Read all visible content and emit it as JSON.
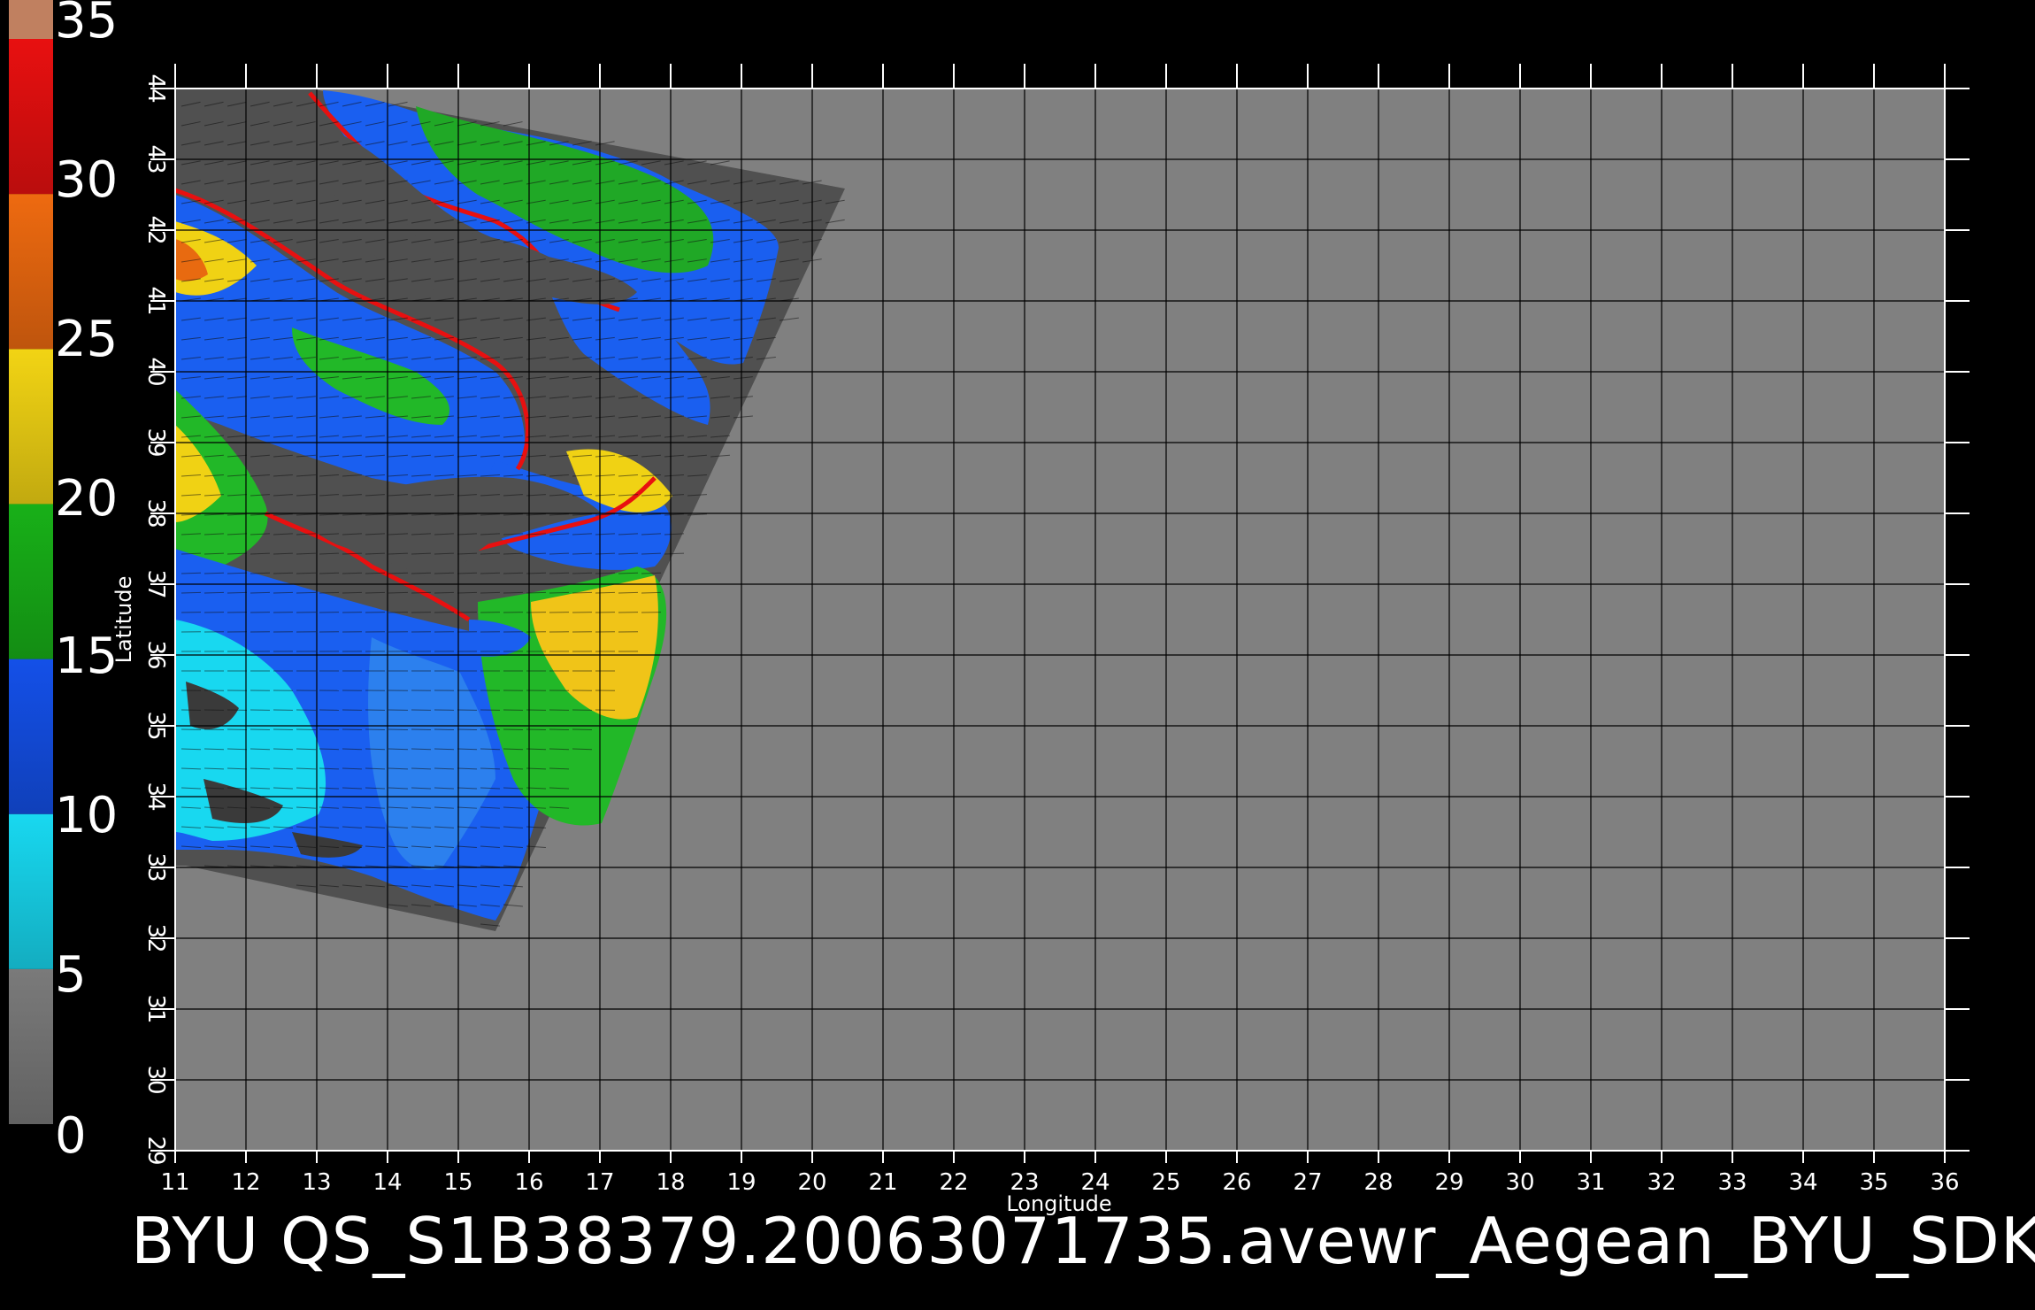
{
  "colorbar": {
    "ticks": [
      "0",
      "5",
      "10",
      "15",
      "20",
      "25",
      "30",
      "35"
    ],
    "min": 0,
    "max": 35,
    "bands": [
      {
        "from": 0,
        "to": 5,
        "color": "#7a7a7a"
      },
      {
        "from": 5,
        "to": 10,
        "color": "#18d8f0"
      },
      {
        "from": 10,
        "to": 15,
        "color": "#1450e8"
      },
      {
        "from": 15,
        "to": 20,
        "color": "#18b018"
      },
      {
        "from": 20,
        "to": 25,
        "color": "#f2d414"
      },
      {
        "from": 25,
        "to": 30,
        "color": "#ee6a10"
      },
      {
        "from": 30,
        "to": 35,
        "color": "#e81010"
      }
    ],
    "top_cap_color": "#c08060"
  },
  "map": {
    "xlabel": "Longitude",
    "ylabel": "Latitude",
    "lon_ticks": [
      "11",
      "12",
      "13",
      "14",
      "15",
      "16",
      "17",
      "18",
      "19",
      "20",
      "21",
      "22",
      "23",
      "24",
      "25",
      "26",
      "27",
      "28",
      "29",
      "30",
      "31",
      "32",
      "33",
      "34",
      "35",
      "36"
    ],
    "lat_ticks": [
      "29",
      "30",
      "31",
      "32",
      "33",
      "34",
      "35",
      "36",
      "37",
      "38",
      "39",
      "40",
      "41",
      "42",
      "43",
      "44"
    ],
    "lon_range": [
      11,
      36
    ],
    "lat_range": [
      29,
      44
    ],
    "background_color": "#808080",
    "swath_color": "#505050",
    "grid_color": "#000000"
  },
  "caption": "BYU  QS_S1B38379.20063071735.avewr_Aegean_BYU_SDK"
}
